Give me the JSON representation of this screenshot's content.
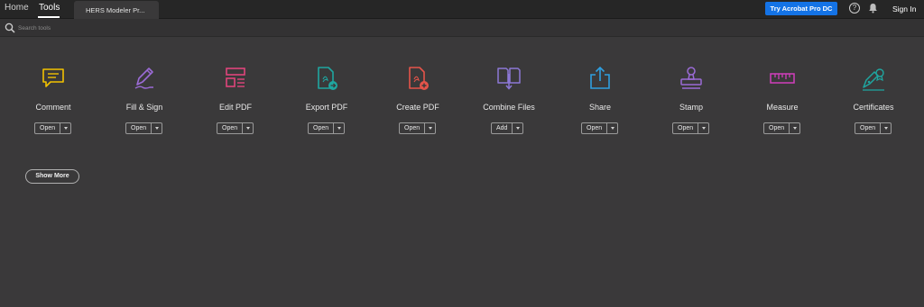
{
  "nav": {
    "home": "Home",
    "tools": "Tools"
  },
  "document_tab": {
    "title": "HERS Modeler Pr..."
  },
  "header": {
    "try_button": "Try Acrobat Pro DC",
    "help_glyph": "?",
    "sign_in": "Sign In"
  },
  "search": {
    "placeholder": "Search tools"
  },
  "colors": {
    "comment": "#f2c200",
    "fill_sign": "#9b6bd6",
    "edit_pdf": "#e0457b",
    "export_pdf": "#1fa6a0",
    "create_pdf": "#e5544a",
    "combine_files": "#8c78d6",
    "share": "#2f9fe0",
    "stamp": "#9b6bd6",
    "measure": "#d13fbd",
    "certificates": "#1fa6a0",
    "accent_blue": "#1473e6"
  },
  "tools": [
    {
      "label": "Comment",
      "icon": "comment-icon",
      "button": "Open"
    },
    {
      "label": "Fill & Sign",
      "icon": "fill-sign-icon",
      "button": "Open"
    },
    {
      "label": "Edit PDF",
      "icon": "edit-pdf-icon",
      "button": "Open"
    },
    {
      "label": "Export PDF",
      "icon": "export-pdf-icon",
      "button": "Open"
    },
    {
      "label": "Create PDF",
      "icon": "create-pdf-icon",
      "button": "Open"
    },
    {
      "label": "Combine Files",
      "icon": "combine-files-icon",
      "button": "Add"
    },
    {
      "label": "Share",
      "icon": "share-icon",
      "button": "Open"
    },
    {
      "label": "Stamp",
      "icon": "stamp-icon",
      "button": "Open"
    },
    {
      "label": "Measure",
      "icon": "measure-icon",
      "button": "Open"
    },
    {
      "label": "Certificates",
      "icon": "certificates-icon",
      "button": "Open"
    }
  ],
  "show_more": "Show More"
}
